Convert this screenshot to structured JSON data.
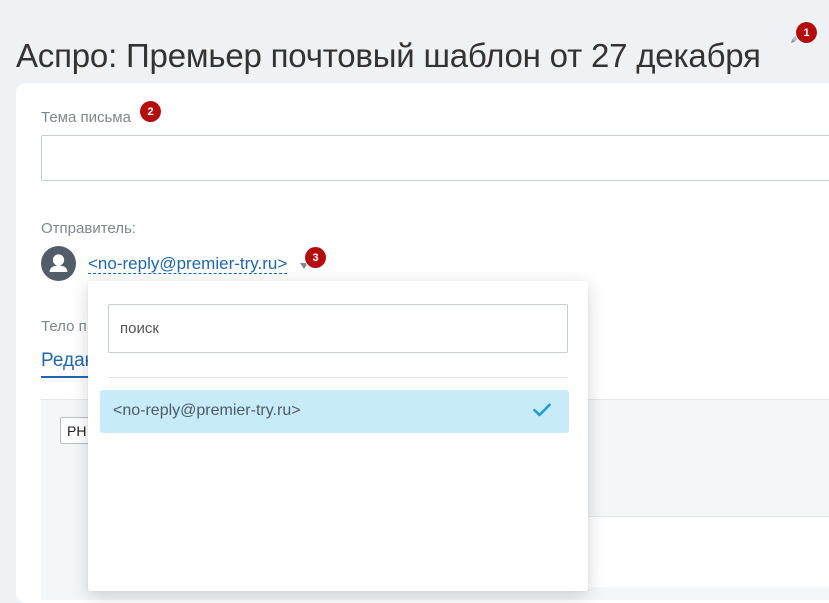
{
  "header": {
    "title": "Аспро: Премьер почтовый шаблон от 27 декабря",
    "edit_icon": "pencil-icon",
    "badge": "1"
  },
  "form": {
    "subject_label": "Тема письма",
    "subject_value": "",
    "subject_badge": "2",
    "sender_label": "Отправитель:",
    "sender_value": "<no-reply@premier-try.ru>",
    "sender_badge": "3",
    "avatar_icon": "user-avatar-icon",
    "body_label": "Тело п",
    "tab_editor": "Редак",
    "toolbar_button": "РН"
  },
  "dropdown": {
    "search_placeholder": "поиск",
    "options": [
      {
        "label": "<no-reply@premier-try.ru>",
        "selected": true
      }
    ],
    "check_icon": "checkmark-icon"
  },
  "colors": {
    "accent": "#2067b0",
    "badge": "#b30d0d",
    "selected_bg": "#c7ebf9",
    "check": "#1e9fd9",
    "page_bg": "#eef2f4"
  }
}
